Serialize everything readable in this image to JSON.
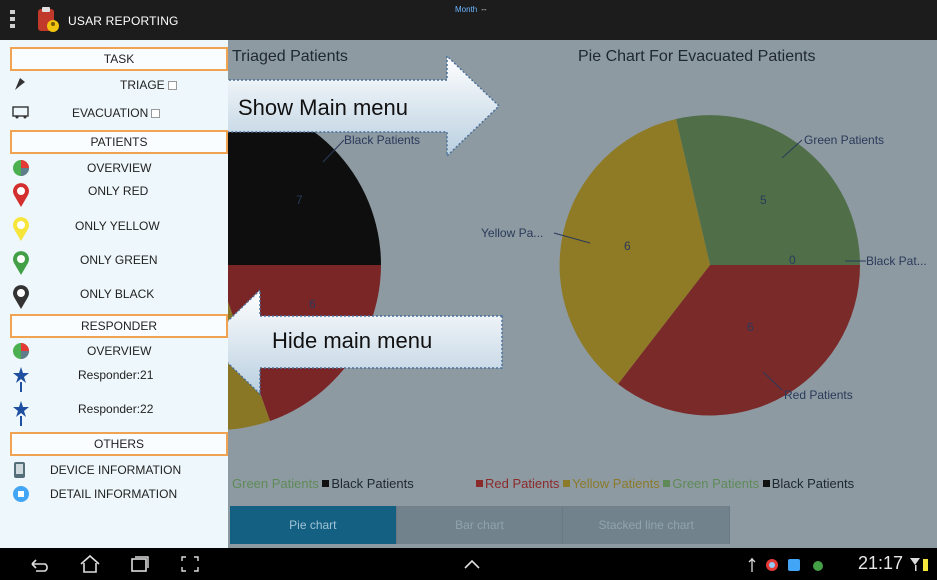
{
  "app": {
    "title": "USAR REPORTING",
    "month_label": "Month",
    "month_value": "--"
  },
  "charts": {
    "left_title": "Triaged Patients",
    "right_title": "Pie Chart For Evacuated Patients",
    "left_labels": {
      "black": "Black Patients",
      "black_value": "7",
      "red_value": "6"
    },
    "right_labels": {
      "green": "Green Patients",
      "yellow": "Yellow Pa...",
      "black": "Black Pat...",
      "red": "Red Patients"
    }
  },
  "chart_data": [
    {
      "type": "pie",
      "title": "Triaged Patients",
      "categories": [
        "Black Patients",
        "Red Patients"
      ],
      "values": [
        7,
        6
      ]
    },
    {
      "type": "pie",
      "title": "Pie Chart For Evacuated Patients",
      "categories": [
        "Green Patients",
        "Black Patients",
        "Red Patients",
        "Yellow Patients"
      ],
      "values": [
        5,
        0,
        6,
        6
      ],
      "colors": [
        "#3e8b3e",
        "#1a1a1a",
        "#c02a2a",
        "#e0a800"
      ]
    }
  ],
  "legend": {
    "left": [
      {
        "label": "Green Patients",
        "swatch": "none"
      },
      {
        "label": "Black Patients",
        "color": "#111111"
      }
    ],
    "right": [
      {
        "label": "Red Patients",
        "color": "#c02a2a"
      },
      {
        "label": "Yellow Patients",
        "color": "#e0a800"
      },
      {
        "label": "Green Patients",
        "color": "#3e8b3e"
      },
      {
        "label": "Black Patients",
        "color": "#111111"
      }
    ]
  },
  "chart_tabs": [
    {
      "label": "Pie chart",
      "active": true
    },
    {
      "label": "Bar chart"
    },
    {
      "label": "Stacked line chart"
    }
  ],
  "menu": {
    "task_header": "TASK",
    "triage": "TRIAGE",
    "evacuation": "EVACUATION",
    "patients_header": "PATIENTS",
    "overview": "OVERVIEW",
    "only_red": "ONLY RED",
    "only_yellow": "ONLY YELLOW",
    "only_green": "ONLY GREEN",
    "only_black": "ONLY BLACK",
    "responder_header": "RESPONDER",
    "responder_overview": "OVERVIEW",
    "responder_21": "Responder:21",
    "responder_22": "Responder:22",
    "others_header": "OTHERS",
    "device_info": "DEVICE INFORMATION",
    "detail_info": "DETAIL INFORMATION"
  },
  "hints": {
    "show": "Show Main menu",
    "hide": "Hide main menu"
  },
  "status": {
    "time": "21:17"
  },
  "colors": {
    "menu_border": "#f0a451",
    "active_tab": "#146082",
    "overlay": "#8d9aa2"
  }
}
